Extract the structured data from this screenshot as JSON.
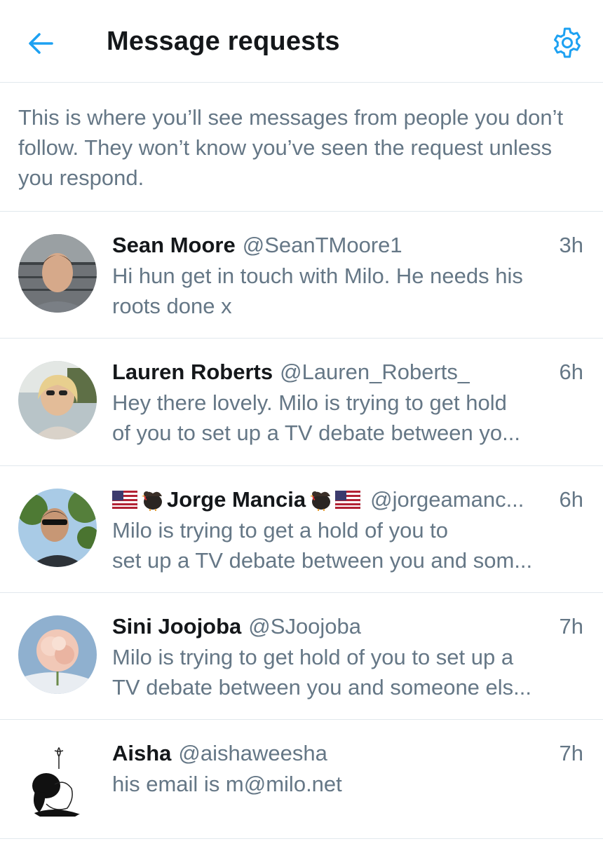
{
  "header": {
    "title": "Message requests",
    "back_icon": "arrow-left-icon",
    "settings_icon": "gear-icon",
    "accent_color": "#1da1f2"
  },
  "intro": "This is where you’ll see messages from people you don’t follow. They won’t know you’ve seen the request unless you respond.",
  "requests": [
    {
      "name": "Sean Moore",
      "handle": "@SeanTMoore1",
      "time": "3h",
      "message_line1": "Hi hun get in touch with Milo. He needs his",
      "message_line2": "roots done x"
    },
    {
      "name": "Lauren Roberts",
      "handle": "@Lauren_Roberts_",
      "time": "6h",
      "message_line1": "Hey there lovely. Milo is trying to get hold",
      "message_line2": "of you to set up a TV debate between yo..."
    },
    {
      "name": "Jorge Mancia",
      "handle": "@jorgeamanc...",
      "time": "6h",
      "message_line1": "Milo is trying to get a hold of you to",
      "message_line2": "set up a TV debate between you and som...",
      "name_emoji": [
        "us-flag-icon",
        "turkey-icon"
      ]
    },
    {
      "name": "Sini Joojoba",
      "handle": "@SJoojoba",
      "time": "7h",
      "message_line1": "Milo is trying to get hold of you to set up a",
      "message_line2": "TV debate between you and someone els..."
    },
    {
      "name": "Aisha",
      "handle": "@aishaweesha",
      "time": "7h",
      "message_line1": "his email is m@milo.net",
      "message_line2": ""
    }
  ]
}
